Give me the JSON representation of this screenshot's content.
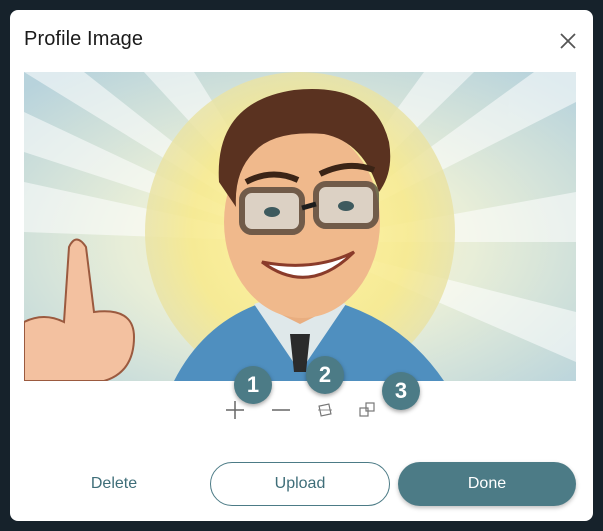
{
  "dialog": {
    "title": "Profile Image",
    "close_icon": "close-icon"
  },
  "image": {
    "subject": "cartoon man with glasses giving thumbs up"
  },
  "toolbar": {
    "zoom_in_icon": "plus-icon",
    "zoom_out_icon": "minus-icon",
    "rotate_icon": "rotate-icon",
    "flip_icon": "flip-icon"
  },
  "badges": [
    "1",
    "2",
    "3"
  ],
  "buttons": {
    "delete": "Delete",
    "upload": "Upload",
    "done": "Done"
  },
  "colors": {
    "accent": "#4c7b86",
    "background": "#16222b"
  }
}
